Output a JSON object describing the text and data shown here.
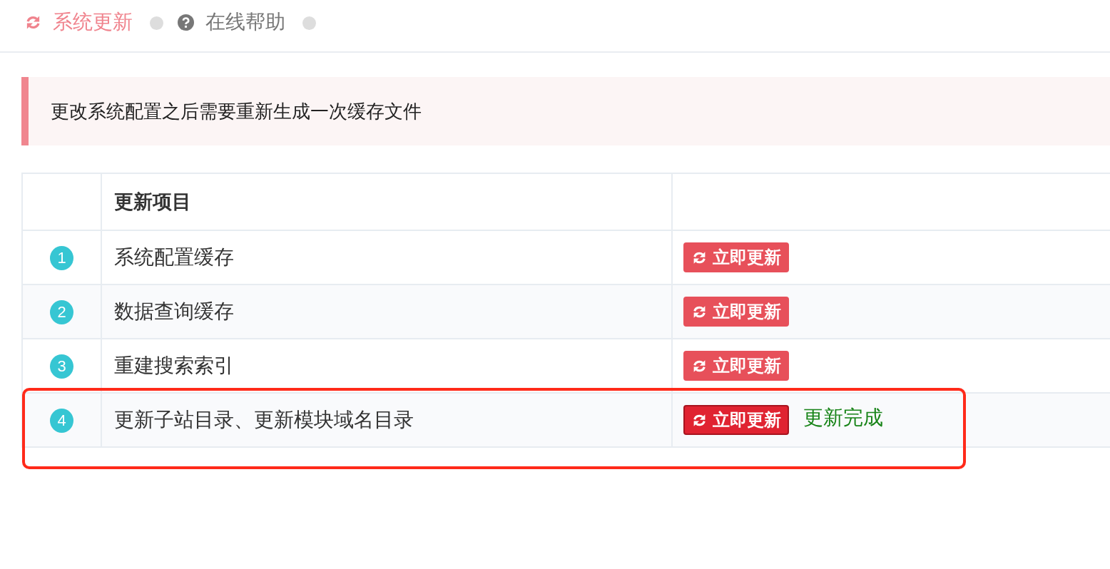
{
  "tabs": [
    {
      "label": "系统更新",
      "kind": "update",
      "selected": true
    },
    {
      "label": "在线帮助",
      "kind": "help",
      "selected": false
    }
  ],
  "alert": {
    "text": "更改系统配置之后需要重新生成一次缓存文件"
  },
  "table": {
    "item_heading": "更新项目",
    "rows": [
      {
        "number": "1",
        "item": "系统配置缓存",
        "button": {
          "label": "立即更新",
          "pressed": false
        },
        "highlighted": false
      },
      {
        "number": "2",
        "item": "数据查询缓存",
        "button": {
          "label": "立即更新",
          "pressed": false
        },
        "highlighted": false
      },
      {
        "number": "3",
        "item": "重建搜索索引",
        "button": {
          "label": "立即更新",
          "pressed": false
        },
        "highlighted": false
      },
      {
        "number": "4",
        "item": "更新子站目录、更新模块域名目录",
        "button": {
          "label": "立即更新",
          "pressed": true
        },
        "status": "更新完成",
        "highlighted": true
      }
    ]
  }
}
